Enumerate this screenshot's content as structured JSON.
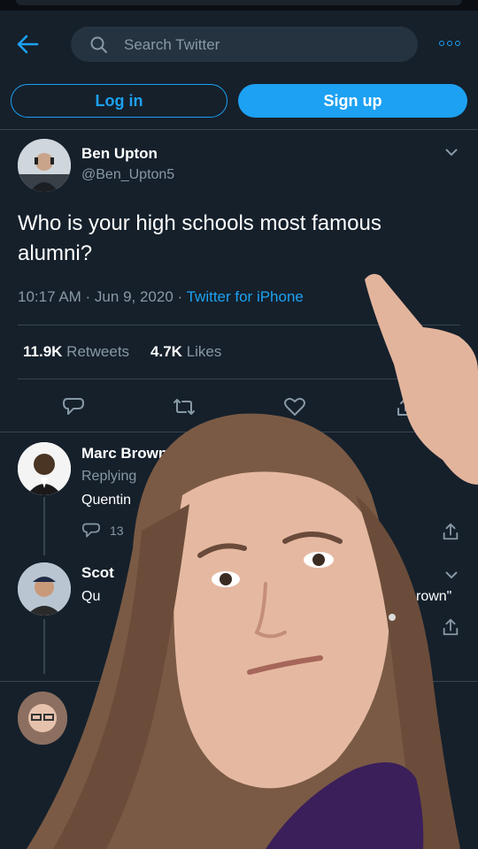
{
  "search": {
    "placeholder": "Search Twitter"
  },
  "auth": {
    "login_label": "Log in",
    "signup_label": "Sign up"
  },
  "tweet": {
    "author_name": "Ben Upton",
    "author_handle": "@Ben_Upton5",
    "text": "Who is your high schools most famous alumni?",
    "time_date": "10:17 AM · Jun 9, 2020 · ",
    "source": "Twitter for iPhone",
    "retweets_count": "11.9K",
    "retweets_label": "Retweets",
    "likes_count": "4.7K",
    "likes_label": "Likes"
  },
  "replies": [
    {
      "name": "Marc Brown",
      "replying": "Replying",
      "body": "Quentin",
      "reply_count": "13"
    },
    {
      "name": "Scot",
      "body_left": "Qu",
      "body_right": "rown\""
    }
  ],
  "colors": {
    "background": "#15202b",
    "accent": "#1da1f2",
    "muted": "#8899a6",
    "divider": "#38444d"
  }
}
